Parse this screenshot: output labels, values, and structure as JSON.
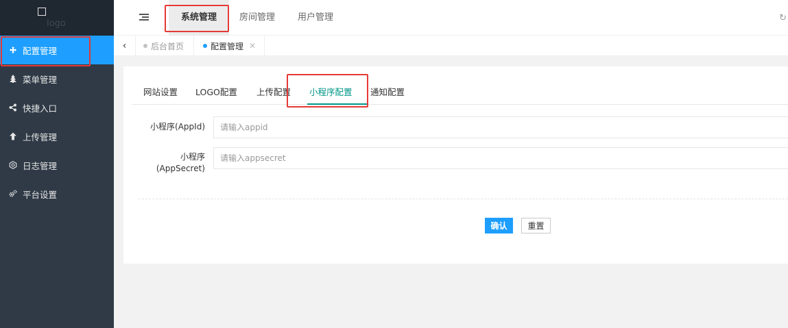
{
  "logo": {
    "text": "logo"
  },
  "sidebar": {
    "items": [
      {
        "label": "配置管理",
        "icon": "move-icon",
        "active": true
      },
      {
        "label": "菜单管理",
        "icon": "tree-icon",
        "active": false
      },
      {
        "label": "快捷入口",
        "icon": "share-icon",
        "active": false
      },
      {
        "label": "上传管理",
        "icon": "upload-arrow-icon",
        "active": false
      },
      {
        "label": "日志管理",
        "icon": "log-icon",
        "active": false
      },
      {
        "label": "平台设置",
        "icon": "gears-icon",
        "active": false
      }
    ]
  },
  "header": {
    "tabs": [
      {
        "label": "系统管理",
        "active": true
      },
      {
        "label": "房间管理",
        "active": false
      },
      {
        "label": "用户管理",
        "active": false
      }
    ]
  },
  "navtabs": {
    "items": [
      {
        "label": "后台首页",
        "active": false,
        "closable": false
      },
      {
        "label": "配置管理",
        "active": true,
        "closable": true
      }
    ]
  },
  "config": {
    "tabs": [
      {
        "label": "网站设置",
        "active": false
      },
      {
        "label": "LOGO配置",
        "active": false
      },
      {
        "label": "上传配置",
        "active": false
      },
      {
        "label": "小程序配置",
        "active": true
      },
      {
        "label": "通知配置",
        "active": false
      }
    ],
    "fields": [
      {
        "label": "小程序(AppId)",
        "placeholder": "请输入appid"
      },
      {
        "label_line1": "小程序",
        "label_line2": "(AppSecret)",
        "placeholder": "请输入appsecret"
      }
    ],
    "confirm_label": "确认",
    "reset_label": "重置"
  },
  "colors": {
    "sidebar_bg": "#2f3a46",
    "active_blue": "#1e9fff",
    "tab_active_green": "#009688",
    "annotation_red": "#e53935"
  }
}
